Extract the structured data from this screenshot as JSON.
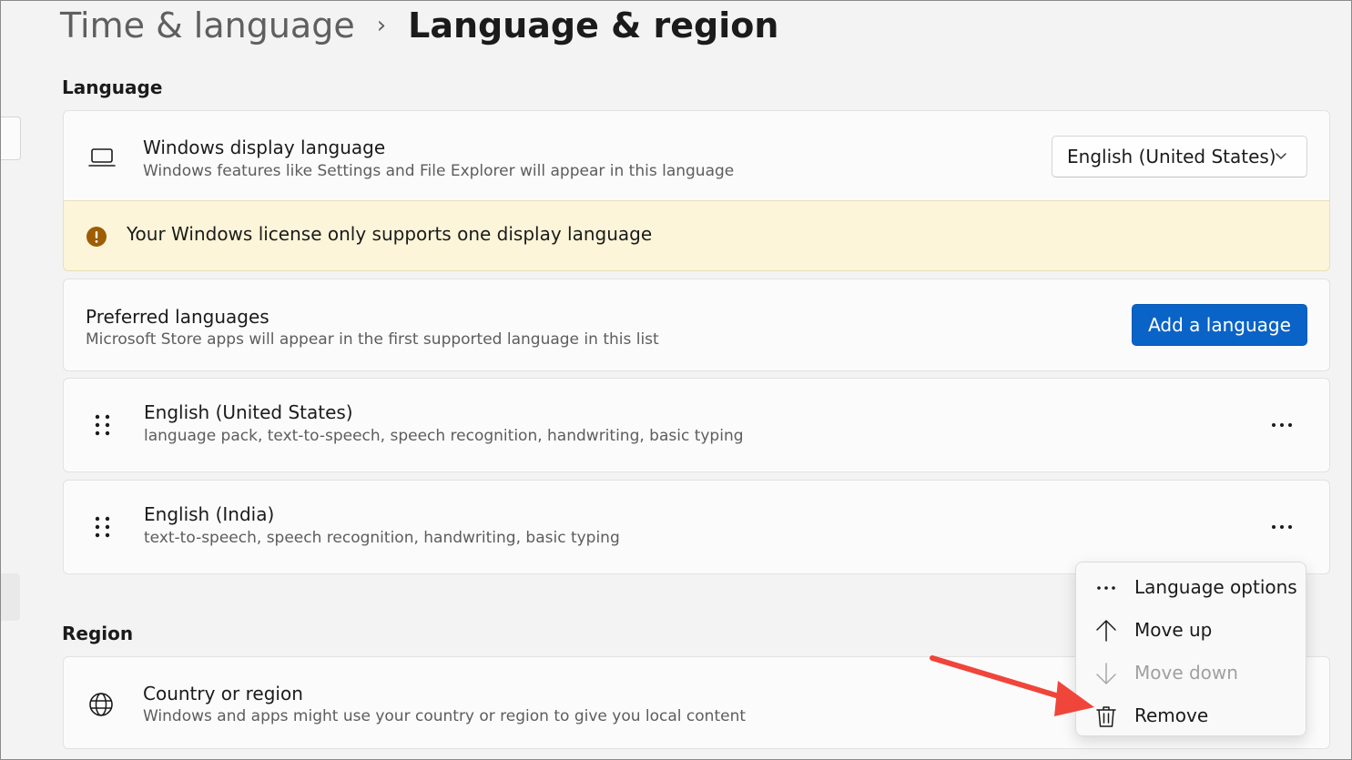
{
  "breadcrumb": {
    "parent": "Time & language",
    "separator": "›",
    "current": "Language & region"
  },
  "language_section": {
    "title": "Language",
    "display_language": {
      "title": "Windows display language",
      "subtitle": "Windows features like Settings and File Explorer will appear in this language",
      "icon": "laptop-icon",
      "selected": "English (United States)"
    },
    "warning": {
      "icon": "warning-icon",
      "text": "Your Windows license only supports one display language",
      "background": "#fcf5d9"
    },
    "preferred": {
      "title": "Preferred languages",
      "subtitle": "Microsoft Store apps will appear in the first supported language in this list",
      "add_button": "Add a language"
    },
    "languages": [
      {
        "name": "English (United States)",
        "features": "language pack, text-to-speech, speech recognition, handwriting, basic typing"
      },
      {
        "name": "English (India)",
        "features": "text-to-speech, speech recognition, handwriting, basic typing"
      }
    ]
  },
  "context_menu": {
    "items": [
      {
        "label": "Language options",
        "icon": "more-icon",
        "enabled": true
      },
      {
        "label": "Move up",
        "icon": "arrow-up-icon",
        "enabled": true
      },
      {
        "label": "Move down",
        "icon": "arrow-down-icon",
        "enabled": false
      },
      {
        "label": "Remove",
        "icon": "trash-icon",
        "enabled": true
      }
    ]
  },
  "region_section": {
    "title": "Region",
    "country": {
      "title": "Country or region",
      "subtitle": "Windows and apps might use your country or region to give you local content",
      "icon": "globe-icon"
    }
  },
  "colors": {
    "accent": "#0a63c7",
    "annotation_arrow": "#f0453a",
    "warning_icon": "#9d5d00"
  }
}
